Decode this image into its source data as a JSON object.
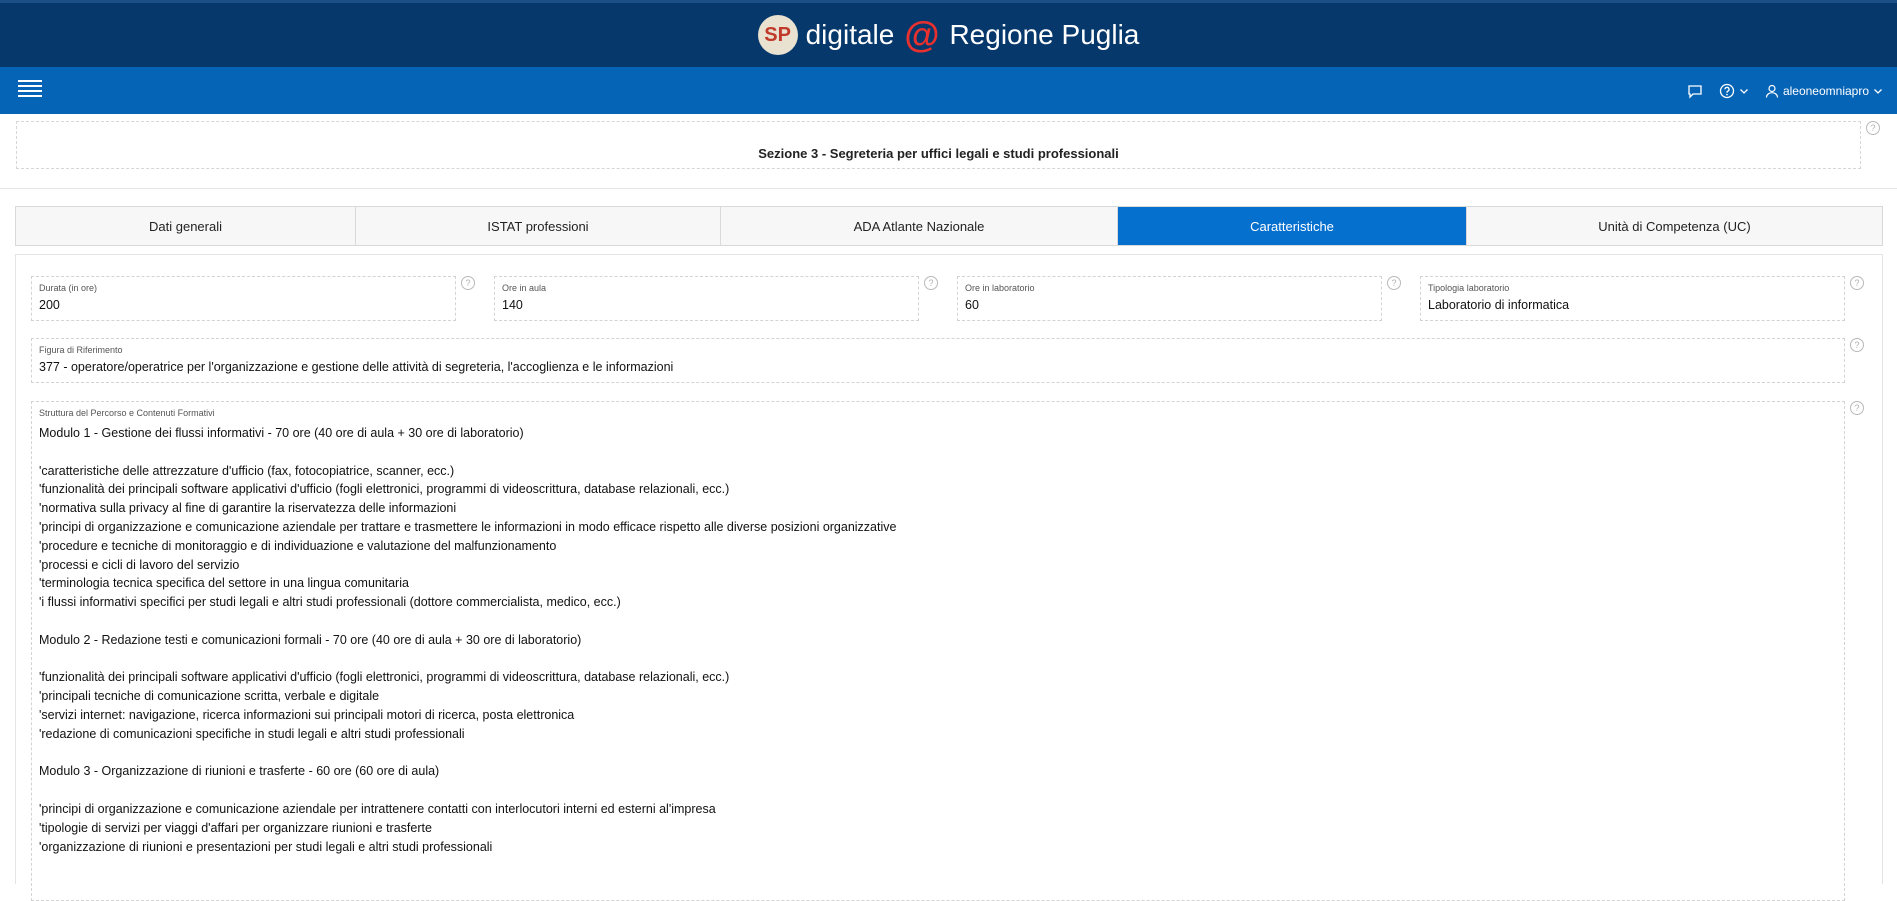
{
  "header": {
    "logo_text": "SP",
    "brand_left": "digitale",
    "brand_at": "@",
    "brand_right": "Regione Puglia"
  },
  "navbar": {
    "username": "aleoneomniapro"
  },
  "section": {
    "title": "Sezione 3 - Segreteria per uffici legali e studi professionali"
  },
  "tabs": [
    {
      "label": "Dati generali",
      "active": false
    },
    {
      "label": "ISTAT professioni",
      "active": false
    },
    {
      "label": "ADA Atlante Nazionale",
      "active": false
    },
    {
      "label": "Caratteristiche",
      "active": true
    },
    {
      "label": "Unità di Competenza (UC)",
      "active": false
    }
  ],
  "fields": {
    "durata": {
      "label": "Durata (in ore)",
      "value": "200"
    },
    "ore_aula": {
      "label": "Ore in aula",
      "value": "140"
    },
    "ore_laboratorio": {
      "label": "Ore in laboratorio",
      "value": "60"
    },
    "tipologia_laboratorio": {
      "label": "Tipologia laboratorio",
      "value": "Laboratorio di informatica"
    },
    "figura": {
      "label": "Figura di Riferimento",
      "value": "377 - operatore/operatrice per l'organizzazione e gestione delle attività di segreteria, l'accoglienza e le informazioni"
    },
    "struttura": {
      "label": "Struttura del Percorso e Contenuti Formativi",
      "lines": [
        "Modulo 1 - Gestione dei flussi informativi - 70 ore (40 ore di aula + 30 ore di laboratorio)",
        "",
        "'caratteristiche delle attrezzature d'ufficio (fax, fotocopiatrice, scanner, ecc.)",
        "'funzionalità dei principali software applicativi d'ufficio (fogli elettronici, programmi di videoscrittura, database relazionali, ecc.)",
        "'normativa sulla privacy al fine di garantire la riservatezza delle informazioni",
        "'principi di organizzazione e comunicazione aziendale per trattare e trasmettere le informazioni in modo efficace rispetto alle diverse posizioni organizzative",
        "'procedure e tecniche di monitoraggio e di individuazione e valutazione del malfunzionamento",
        "'processi e cicli di lavoro del servizio",
        "'terminologia tecnica specifica del settore in una lingua comunitaria",
        "'i flussi informativi specifici per studi legali e altri studi professionali (dottore commercialista, medico, ecc.)",
        "",
        "Modulo 2 - Redazione testi e comunicazioni formali - 70 ore (40 ore di aula + 30 ore di laboratorio)",
        "",
        "'funzionalità dei principali software applicativi d'ufficio (fogli elettronici, programmi di videoscrittura, database relazionali, ecc.)",
        "'principali tecniche di comunicazione scritta, verbale e digitale",
        "'servizi internet: navigazione, ricerca informazioni sui principali motori di ricerca, posta elettronica",
        "'redazione di comunicazioni specifiche in studi legali e altri studi professionali",
        "",
        "Modulo 3 - Organizzazione di riunioni e trasferte - 60 ore (60 ore di aula)",
        "",
        "'principi di organizzazione e comunicazione aziendale per intrattenere contatti con interlocutori interni ed esterni al'impresa",
        "'tipologie di servizi per viaggi d'affari per organizzare riunioni e trasferte",
        "'organizzazione di riunioni e presentazioni per studi legali e altri studi professionali"
      ]
    }
  },
  "icons": {
    "help": "question-circle-icon",
    "chat": "chat-icon",
    "user": "user-icon",
    "menu": "hamburger-menu-icon"
  },
  "colors": {
    "header_bg": "#06386c",
    "navbar_bg": "#0664b6",
    "tab_active": "#0670cf"
  }
}
